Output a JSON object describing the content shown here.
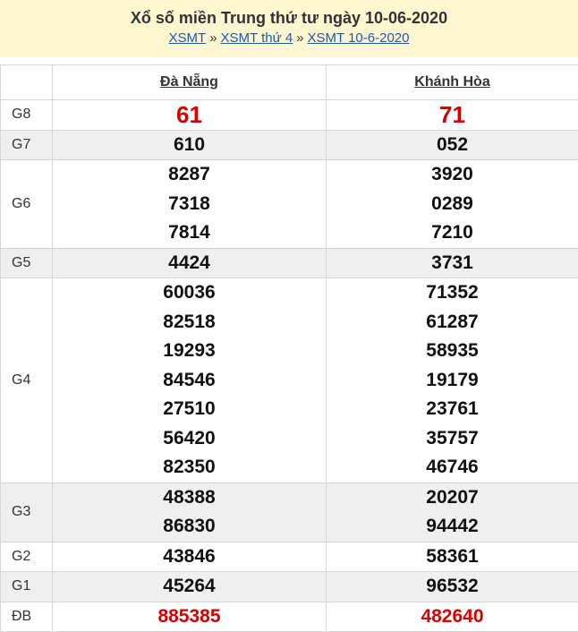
{
  "header": {
    "title": "Xổ số miền Trung thứ tư ngày 10-06-2020",
    "breadcrumbs": [
      "XSMT",
      "XSMT thứ 4",
      "XSMT 10-6-2020"
    ],
    "separator": "»"
  },
  "table": {
    "columns": [
      "Đà Nẵng",
      "Khánh Hòa"
    ],
    "rows": [
      {
        "label": "G8",
        "values": [
          [
            "61"
          ],
          [
            "71"
          ]
        ],
        "red": true,
        "alt": false
      },
      {
        "label": "G7",
        "values": [
          [
            "610"
          ],
          [
            "052"
          ]
        ],
        "red": false,
        "alt": true
      },
      {
        "label": "G6",
        "values": [
          [
            "8287",
            "7318",
            "7814"
          ],
          [
            "3920",
            "0289",
            "7210"
          ]
        ],
        "red": false,
        "alt": false
      },
      {
        "label": "G5",
        "values": [
          [
            "4424"
          ],
          [
            "3731"
          ]
        ],
        "red": false,
        "alt": true
      },
      {
        "label": "G4",
        "values": [
          [
            "60036",
            "82518",
            "19293",
            "84546",
            "27510",
            "56420",
            "82350"
          ],
          [
            "71352",
            "61287",
            "58935",
            "19179",
            "23761",
            "35757",
            "46746"
          ]
        ],
        "red": false,
        "alt": false
      },
      {
        "label": "G3",
        "values": [
          [
            "48388",
            "86830"
          ],
          [
            "20207",
            "94442"
          ]
        ],
        "red": false,
        "alt": true
      },
      {
        "label": "G2",
        "values": [
          [
            "43846"
          ],
          [
            "58361"
          ]
        ],
        "red": false,
        "alt": false
      },
      {
        "label": "G1",
        "values": [
          [
            "45264"
          ],
          [
            "96532"
          ]
        ],
        "red": false,
        "alt": true
      },
      {
        "label": "ĐB",
        "values": [
          [
            "885385"
          ],
          [
            "482640"
          ]
        ],
        "red": true,
        "alt": false
      }
    ]
  }
}
